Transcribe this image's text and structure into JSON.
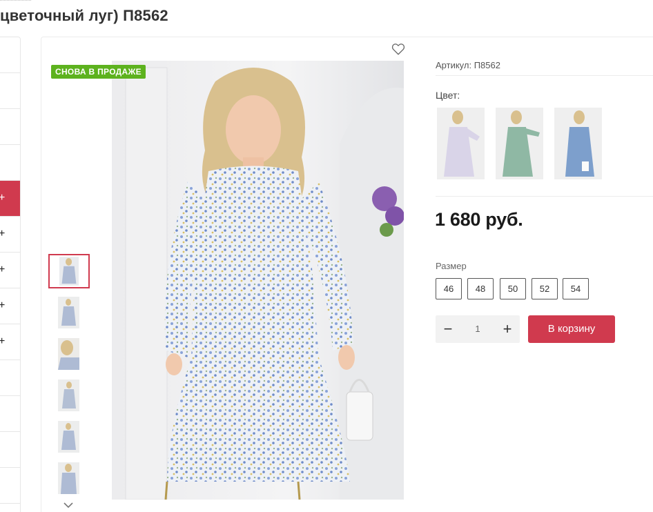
{
  "product": {
    "title": "цветочный луг) П8562",
    "badge": "СНОВА В ПРОДАЖЕ",
    "sku": "Артикул: П8562",
    "color_label": "Цвет:",
    "price": "1 680 руб.",
    "size_label": "Размер",
    "sizes": [
      "46",
      "48",
      "50",
      "52",
      "54"
    ],
    "quantity": "1",
    "cart_label": "В корзину",
    "swatches": [
      {
        "name": "lavender-floral",
        "color": "#d9d4e8"
      },
      {
        "name": "mint-floral",
        "color": "#8fb8a4"
      },
      {
        "name": "blue-floral",
        "color": "#7d9fcc"
      }
    ],
    "thumbnail_count": 6,
    "active_thumbnail": 0
  },
  "icons": {
    "favorite": "heart-outline-icon",
    "thumbs_more": "chevron-down-icon",
    "qty_minus": "−",
    "qty_plus": "+"
  },
  "sidebar": {
    "active_index": 4,
    "expand_glyph": "+"
  },
  "colors": {
    "accent": "#d03a4e",
    "badge": "#5db21e"
  }
}
